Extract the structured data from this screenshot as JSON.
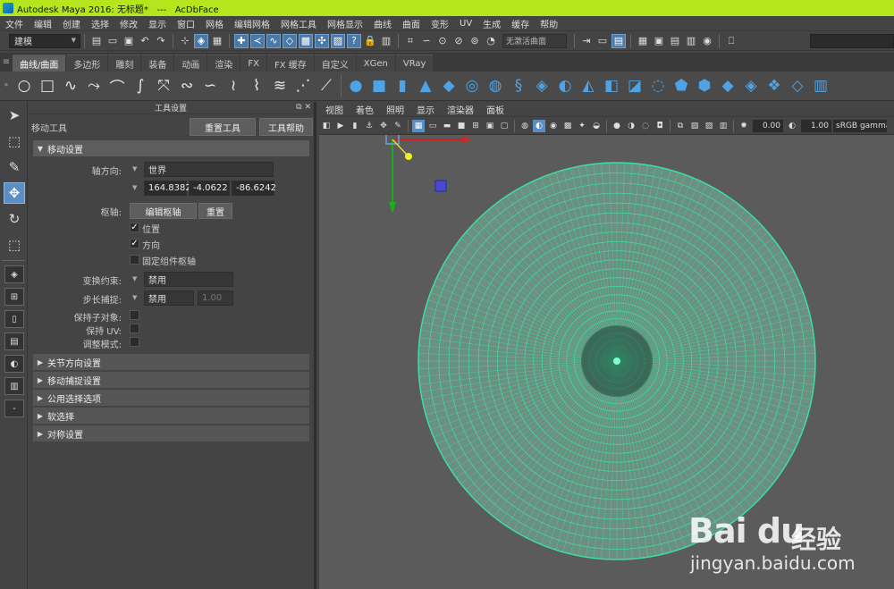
{
  "titlebar": {
    "title": "Autodesk Maya 2016: 无标题*   ---   AcDbFace"
  },
  "menubar": {
    "items": [
      "文件",
      "编辑",
      "创建",
      "选择",
      "修改",
      "显示",
      "窗口",
      "网格",
      "编辑网格",
      "网格工具",
      "网格显示",
      "曲线",
      "曲面",
      "变形",
      "UV",
      "生成",
      "缓存",
      "帮助"
    ]
  },
  "statusline": {
    "mode": "建模",
    "live_surface": "无激活曲面"
  },
  "shelf": {
    "tabs": [
      "曲线/曲面",
      "多边形",
      "雕刻",
      "装备",
      "动画",
      "渲染",
      "FX",
      "FX 缓存",
      "自定义",
      "XGen",
      "VRay"
    ],
    "active_tab": "曲线/曲面"
  },
  "tool_settings": {
    "header": "工具设置",
    "tool_name": "移动工具",
    "reset_button": "重置工具",
    "help_button": "工具帮助",
    "move_settings": {
      "title": "移动设置",
      "axis_orientation_label": "轴方向:",
      "axis_orientation_value": "世界",
      "coord_x": "164.8382",
      "coord_y": "-4.0622",
      "coord_z": "-86.6242",
      "pivot_label": "枢轴:",
      "edit_pivot_button": "编辑枢轴",
      "reset_pivot_button": "重置",
      "position_label": "位置",
      "direction_label": "方向",
      "pin_pivot_label": "固定组件枢轴",
      "transform_constraint_label": "变换约束:",
      "transform_constraint_value": "禁用",
      "step_snap_label": "步长捕捉:",
      "step_snap_value": "禁用",
      "step_snap_amount": "1.00",
      "preserve_children_label": "保持子对象:",
      "preserve_uvs_label": "保持 UV:",
      "tweak_mode_label": "调整模式:"
    },
    "sections": [
      "关节方向设置",
      "移动捕捉设置",
      "公用选择选项",
      "软选择",
      "对称设置"
    ]
  },
  "viewport": {
    "menu": [
      "视图",
      "着色",
      "照明",
      "显示",
      "渲染器",
      "面板"
    ],
    "exposure": "0.00",
    "gamma": "1.00",
    "color_space": "sRGB gamma",
    "mesh_color": "#3de0a0",
    "background_color": "#5b5b5b"
  },
  "watermark": {
    "brand": "Bai du",
    "jingyan": "经验",
    "url": "jingyan.baidu.com"
  }
}
